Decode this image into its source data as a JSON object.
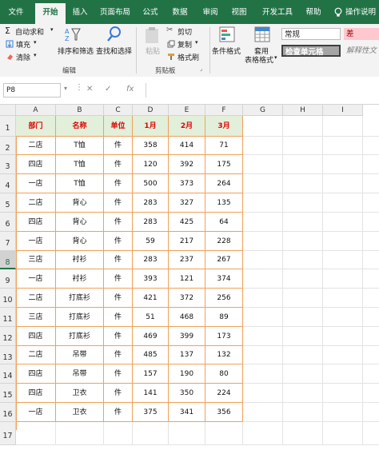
{
  "ribbon_tabs": [
    "文件",
    "开始",
    "插入",
    "页面布局",
    "公式",
    "数据",
    "审阅",
    "视图",
    "开发工具",
    "帮助",
    "操作说明"
  ],
  "active_tab": 1,
  "ribbon": {
    "autosum": "自动求和",
    "fill": "填充",
    "clear": "清除",
    "sort_filter": "排序和筛选",
    "find_select": "查找和选择",
    "edit_group": "编辑",
    "paste": "粘贴",
    "cut": "剪切",
    "copy": "复制",
    "format_painter": "格式刷",
    "clipboard_group": "剪贴板",
    "cond_format": "条件格式",
    "table_format_1": "套用",
    "table_format_2": "表格格式",
    "style_normal": "常规",
    "style_bad": "差",
    "style_check": "检查单元格",
    "style_explain": "解释性文"
  },
  "colors": {
    "ribbon_green": "#217346",
    "header_fill": "#e2efda",
    "header_text": "#e00000",
    "border_orange": "#f0a15a"
  },
  "formula_bar": {
    "name_box": "P8",
    "fx": "fx",
    "formula": ""
  },
  "columns": [
    "A",
    "B",
    "C",
    "D",
    "E",
    "F",
    "G",
    "H",
    "I"
  ],
  "rows": [
    "1",
    "2",
    "3",
    "4",
    "5",
    "6",
    "7",
    "8",
    "9",
    "10",
    "11",
    "12",
    "13",
    "14",
    "15",
    "16",
    "17"
  ],
  "selected_row": 8,
  "table": {
    "headers": [
      "部门",
      "名称",
      "单位",
      "1月",
      "2月",
      "3月"
    ],
    "rows": [
      [
        "二店",
        "T恤",
        "件",
        "358",
        "414",
        "71"
      ],
      [
        "四店",
        "T恤",
        "件",
        "120",
        "392",
        "175"
      ],
      [
        "一店",
        "T恤",
        "件",
        "500",
        "373",
        "264"
      ],
      [
        "二店",
        "背心",
        "件",
        "283",
        "327",
        "135"
      ],
      [
        "四店",
        "背心",
        "件",
        "283",
        "425",
        "64"
      ],
      [
        "一店",
        "背心",
        "件",
        "59",
        "217",
        "228"
      ],
      [
        "三店",
        "衬衫",
        "件",
        "283",
        "237",
        "267"
      ],
      [
        "一店",
        "衬衫",
        "件",
        "393",
        "121",
        "374"
      ],
      [
        "二店",
        "打底衫",
        "件",
        "421",
        "372",
        "256"
      ],
      [
        "三店",
        "打底衫",
        "件",
        "51",
        "468",
        "89"
      ],
      [
        "四店",
        "打底衫",
        "件",
        "469",
        "399",
        "173"
      ],
      [
        "二店",
        "吊带",
        "件",
        "485",
        "137",
        "132"
      ],
      [
        "四店",
        "吊带",
        "件",
        "157",
        "190",
        "80"
      ],
      [
        "四店",
        "卫衣",
        "件",
        "141",
        "350",
        "224"
      ],
      [
        "一店",
        "卫衣",
        "件",
        "375",
        "341",
        "356"
      ]
    ]
  }
}
